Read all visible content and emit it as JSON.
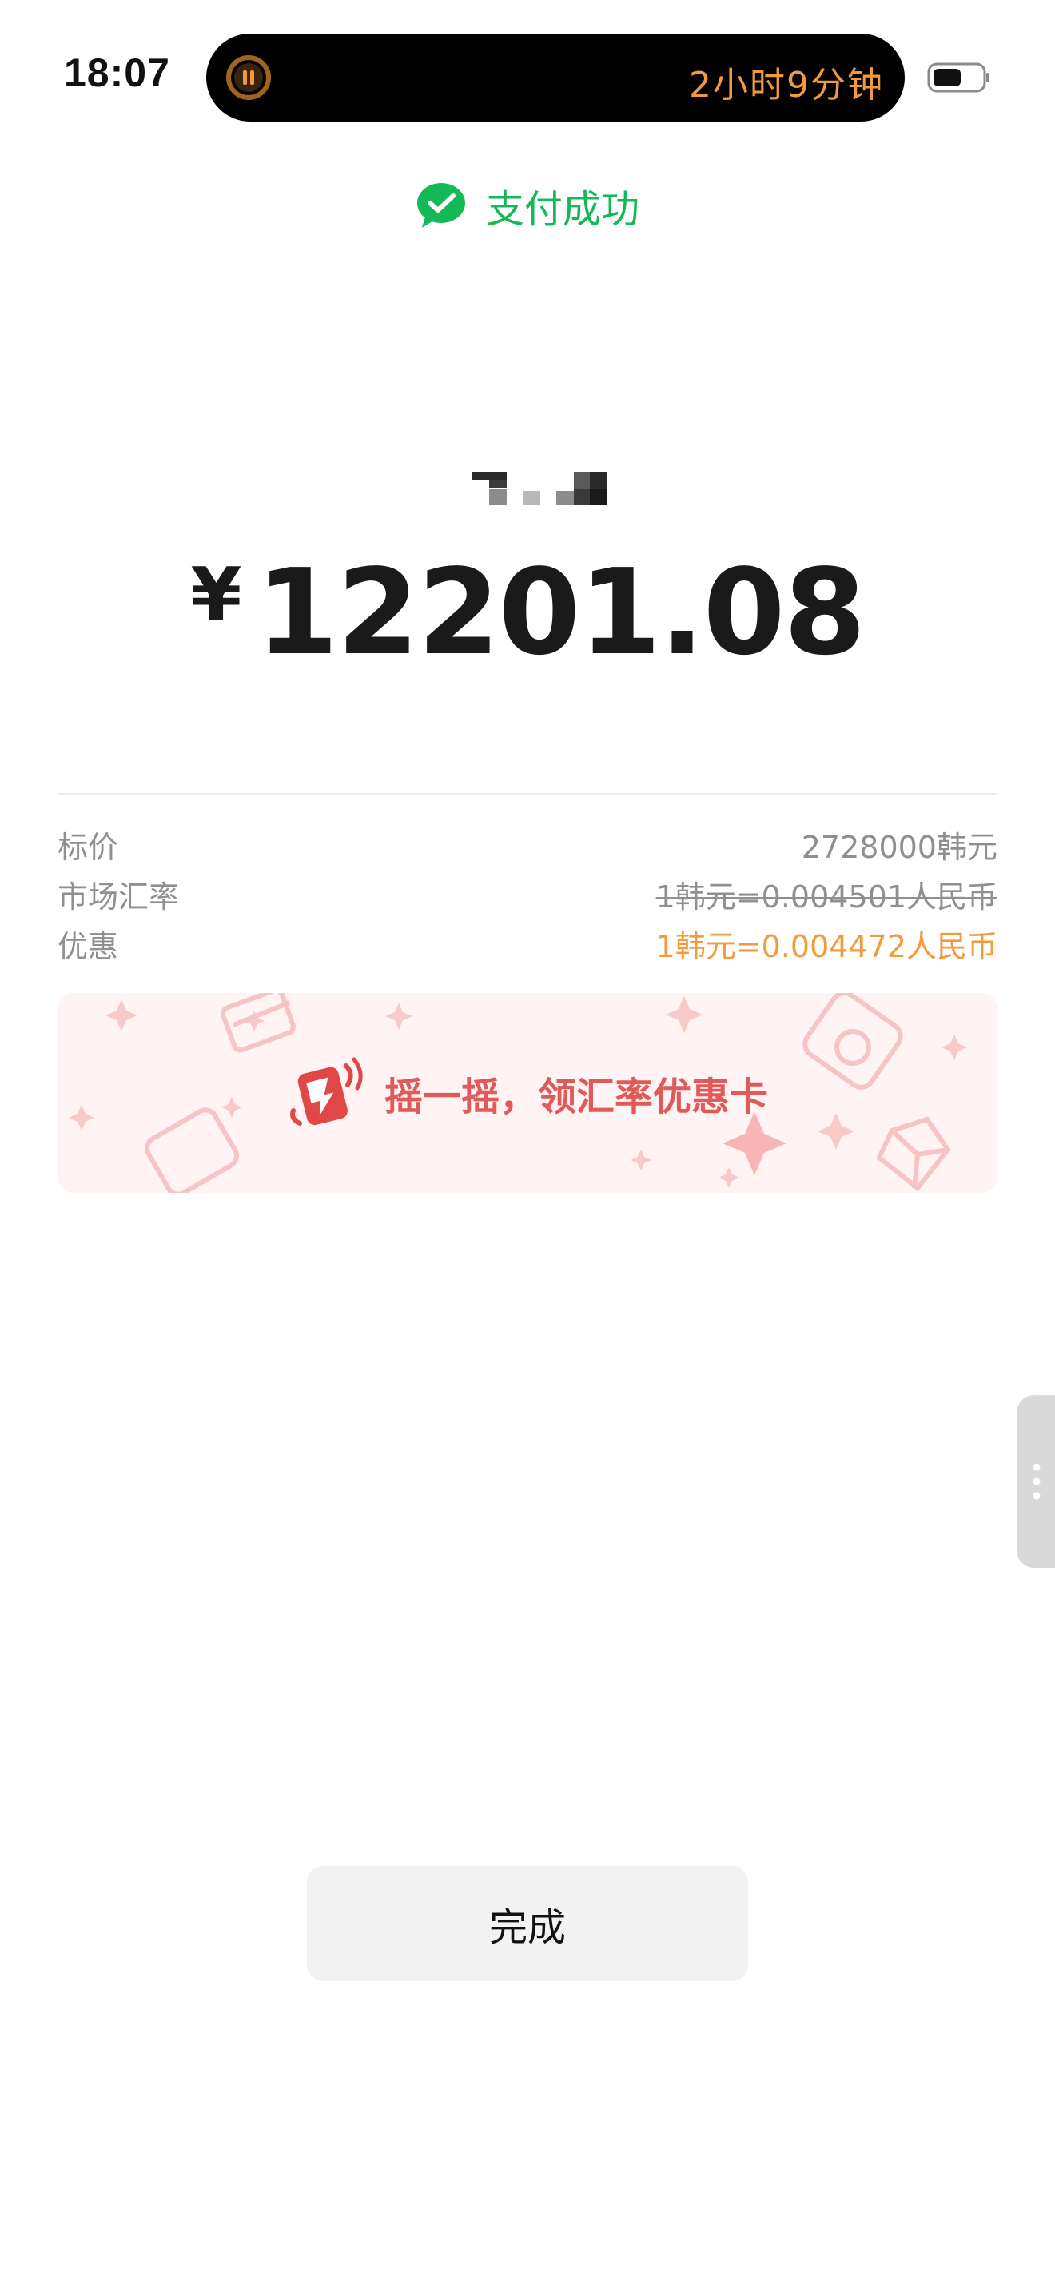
{
  "status_bar": {
    "time": "18:07",
    "live_activity_timer": "2小时9分钟",
    "pause_icon": "pause-circle-icon",
    "battery_icon": "battery-icon"
  },
  "header": {
    "success_icon": "wechat-pay-check-icon",
    "success_text": "支付成功"
  },
  "payment": {
    "merchant_name_icon": "pixelated-merchant-name",
    "currency_symbol": "¥",
    "amount": "12201.08"
  },
  "details": [
    {
      "label": "标价",
      "value": "2728000韩元"
    },
    {
      "label": "市场汇率",
      "value": "1韩元=0.004501人民币"
    },
    {
      "label": "优惠",
      "value": "1韩元=0.004472人民币"
    }
  ],
  "promo": {
    "icon": "shake-phone-icon",
    "text": "摇一摇，领汇率优惠卡"
  },
  "side_handle": {
    "icon": "vertical-dots-icon"
  },
  "done_button": {
    "label": "完成"
  },
  "colors": {
    "success_green": "#14b957",
    "discount_orange": "#f39a3c",
    "promo_red": "#e05a5a",
    "promo_background": "#fff3f3"
  }
}
